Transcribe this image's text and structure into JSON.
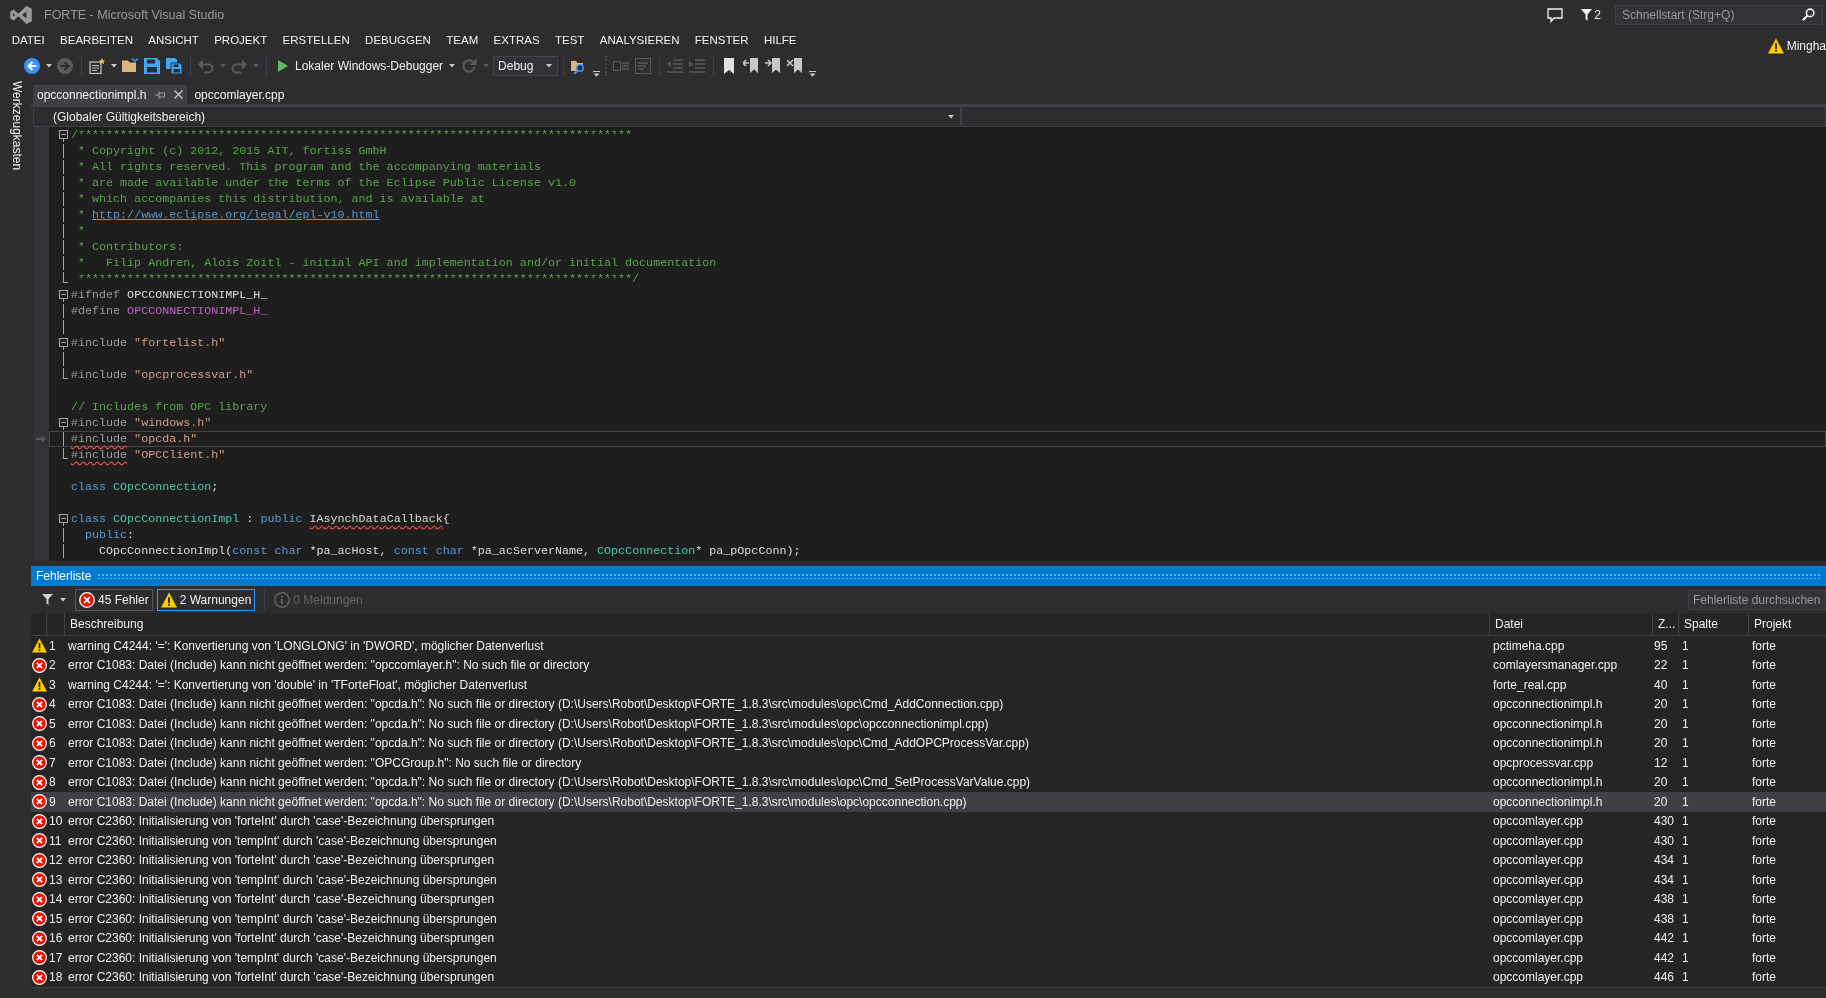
{
  "window": {
    "title": "FORTE - Microsoft Visual Studio",
    "notifications": "2",
    "quick_launch": {
      "placeholder": "Schnellstart (Strg+Q)"
    }
  },
  "menu_bar": {
    "items": [
      "DATEI",
      "BEARBEITEN",
      "ANSICHT",
      "PROJEKT",
      "ERSTELLEN",
      "DEBUGGEN",
      "TEAM",
      "EXTRAS",
      "TEST",
      "ANALYSIEREN",
      "FENSTER",
      "HILFE"
    ],
    "user": "Mingha"
  },
  "toolbar": {
    "items": [
      {
        "kind": "back",
        "disabled": false,
        "dropdown": true
      },
      {
        "kind": "forward",
        "disabled": true,
        "dropdown": false
      },
      {
        "kind": "separator"
      },
      {
        "kind": "new_project",
        "disabled": false,
        "dropdown": true
      },
      {
        "kind": "open",
        "disabled": false,
        "dropdown": false
      },
      {
        "kind": "save",
        "disabled": false,
        "dropdown": false
      },
      {
        "kind": "save_all",
        "disabled": false,
        "dropdown": false
      },
      {
        "kind": "separator"
      },
      {
        "kind": "undo",
        "disabled": true,
        "dropdown": true
      },
      {
        "kind": "redo",
        "disabled": true,
        "dropdown": true
      },
      {
        "kind": "separator"
      },
      {
        "kind": "start",
        "label": "Lokaler Windows-Debugger",
        "disabled": false,
        "dropdown": true
      },
      {
        "kind": "refresh",
        "disabled": true,
        "dropdown": true
      },
      {
        "kind": "select",
        "value": "Debug"
      },
      {
        "kind": "separator"
      },
      {
        "kind": "find",
        "disabled": false,
        "dropdown": false
      },
      {
        "kind": "overflow"
      },
      {
        "kind": "grip"
      },
      {
        "kind": "member_list",
        "disabled": true,
        "dropdown": false
      },
      {
        "kind": "parameter_info",
        "disabled": true,
        "dropdown": false
      },
      {
        "kind": "separator"
      },
      {
        "kind": "outdent",
        "disabled": true,
        "dropdown": false
      },
      {
        "kind": "indent",
        "disabled": true,
        "dropdown": false
      },
      {
        "kind": "separator"
      },
      {
        "kind": "bookmark",
        "disabled": false,
        "dropdown": false
      },
      {
        "kind": "bookmark_prev",
        "disabled": false,
        "dropdown": false
      },
      {
        "kind": "bookmark_next",
        "disabled": false,
        "dropdown": false
      },
      {
        "kind": "bookmark_clear",
        "disabled": false,
        "dropdown": false
      },
      {
        "kind": "overflow"
      }
    ]
  },
  "sidebar": {
    "tabs": [
      "Werkzeugkasten"
    ]
  },
  "tabs": [
    {
      "label": "opcconnectionimpl.h",
      "selected": true
    },
    {
      "label": "opccomlayer.cpp",
      "selected": false
    }
  ],
  "scope_bar": {
    "scope": "(Globaler Gültigkeitsbereich)"
  },
  "editor": {
    "lines": [
      {
        "kind": "open",
        "current": false,
        "tokens": [
          {
            "text": "/*******************************************************************************",
            "kind": "comment",
            "squiggle": false
          }
        ]
      },
      {
        "kind": "inner",
        "current": false,
        "tokens": [
          {
            "text": " * Copyright (c) 2012, 2015 AIT, fortiss GmbH",
            "kind": "comment",
            "squiggle": false
          }
        ]
      },
      {
        "kind": "inner",
        "current": false,
        "tokens": [
          {
            "text": " * All rights reserved. This program and the accompanying materials",
            "kind": "comment",
            "squiggle": false
          }
        ]
      },
      {
        "kind": "inner",
        "current": false,
        "tokens": [
          {
            "text": " * are made available under the terms of the Eclipse Public License v1.0",
            "kind": "comment",
            "squiggle": false
          }
        ]
      },
      {
        "kind": "inner",
        "current": false,
        "tokens": [
          {
            "text": " * which accompanies this distribution, and is available at",
            "kind": "comment",
            "squiggle": false
          }
        ]
      },
      {
        "kind": "inner",
        "current": false,
        "tokens": [
          {
            "text": " * ",
            "kind": "comment",
            "squiggle": false
          },
          {
            "text": "http://www.eclipse.org/legal/epl-v10.html",
            "kind": "link",
            "squiggle": false
          }
        ]
      },
      {
        "kind": "inner",
        "current": false,
        "tokens": [
          {
            "text": " *",
            "kind": "comment",
            "squiggle": false
          }
        ]
      },
      {
        "kind": "inner",
        "current": false,
        "tokens": [
          {
            "text": " * Contributors:",
            "kind": "comment",
            "squiggle": false
          }
        ]
      },
      {
        "kind": "inner",
        "current": false,
        "tokens": [
          {
            "text": " *   Filip Andren, Alois Zoitl - initial API and implementation and/or initial documentation",
            "kind": "comment",
            "squiggle": false
          }
        ]
      },
      {
        "kind": "end",
        "current": false,
        "tokens": [
          {
            "text": " *******************************************************************************/",
            "kind": "comment",
            "squiggle": false
          }
        ]
      },
      {
        "kind": "open",
        "current": false,
        "tokens": [
          {
            "text": "#ifndef",
            "kind": "directive",
            "squiggle": false
          },
          {
            "text": " OPCCONNECTIONIMPL_H_",
            "kind": "plain",
            "squiggle": false
          }
        ]
      },
      {
        "kind": "inner",
        "current": false,
        "tokens": [
          {
            "text": "#define",
            "kind": "directive",
            "squiggle": false
          },
          {
            "text": " OPCCONNECTIONIMPL_H_",
            "kind": "macro",
            "squiggle": false
          }
        ]
      },
      {
        "kind": "inner",
        "current": false
      },
      {
        "kind": "open",
        "current": false,
        "tokens": [
          {
            "text": "#include",
            "kind": "directive",
            "squiggle": false
          },
          {
            "text": " \"fortelist.h\"",
            "kind": "string",
            "squiggle": false
          }
        ]
      },
      {
        "kind": "inner",
        "current": false
      },
      {
        "kind": "end",
        "current": false,
        "tokens": [
          {
            "text": "#include",
            "kind": "directive",
            "squiggle": false
          },
          {
            "text": " \"opcprocessvar.h\"",
            "kind": "string",
            "squiggle": false
          }
        ]
      },
      {
        "kind": "none",
        "current": false
      },
      {
        "kind": "none",
        "current": false,
        "tokens": [
          {
            "text": "// Includes from OPC library",
            "kind": "comment",
            "squiggle": false
          }
        ]
      },
      {
        "kind": "open",
        "current": false,
        "tokens": [
          {
            "text": "#include",
            "kind": "directive",
            "squiggle": false
          },
          {
            "text": " \"windows.h\"",
            "kind": "string",
            "squiggle": false
          }
        ]
      },
      {
        "kind": "inner",
        "current": true,
        "tokens": [
          {
            "text": "#include",
            "kind": "directive",
            "squiggle": true
          },
          {
            "text": " \"opcda.h\"",
            "kind": "string",
            "squiggle": false
          }
        ]
      },
      {
        "kind": "end",
        "current": false,
        "tokens": [
          {
            "text": "#include",
            "kind": "directive",
            "squiggle": true
          },
          {
            "text": " \"OPCClient.h\"",
            "kind": "string",
            "squiggle": false
          }
        ]
      },
      {
        "kind": "none",
        "current": false
      },
      {
        "kind": "none",
        "current": false,
        "tokens": [
          {
            "text": "class",
            "kind": "keyword",
            "squiggle": false
          },
          {
            "text": " COpcConnection",
            "kind": "type",
            "squiggle": false
          },
          {
            "text": ";",
            "kind": "plain",
            "squiggle": false
          }
        ]
      },
      {
        "kind": "none",
        "current": false
      },
      {
        "kind": "open",
        "current": false,
        "tokens": [
          {
            "text": "class",
            "kind": "keyword",
            "squiggle": false
          },
          {
            "text": " COpcConnectionImpl",
            "kind": "type",
            "squiggle": false
          },
          {
            "text": " : ",
            "kind": "plain",
            "squiggle": false
          },
          {
            "text": "public ",
            "kind": "keyword",
            "squiggle": false
          },
          {
            "text": "IAsynchDataCallback",
            "kind": "plain",
            "squiggle": true
          },
          {
            "text": "{",
            "kind": "plain",
            "squiggle": false
          }
        ]
      },
      {
        "kind": "inner",
        "current": false,
        "tokens": [
          {
            "text": "  public",
            "kind": "keyword",
            "squiggle": false
          },
          {
            "text": ":",
            "kind": "plain",
            "squiggle": false
          }
        ]
      },
      {
        "kind": "inner",
        "current": false,
        "tokens": [
          {
            "text": "    COpcConnectionImpl(",
            "kind": "plain",
            "squiggle": false
          },
          {
            "text": "const char",
            "kind": "keyword",
            "squiggle": false
          },
          {
            "text": " *pa_acHost, ",
            "kind": "plain",
            "squiggle": false
          },
          {
            "text": "const char",
            "kind": "keyword",
            "squiggle": false
          },
          {
            "text": " *pa_acServerName, ",
            "kind": "plain",
            "squiggle": false
          },
          {
            "text": "COpcConnection",
            "kind": "type",
            "squiggle": false
          },
          {
            "text": "* pa_pOpcConn);",
            "kind": "plain",
            "squiggle": false
          }
        ]
      }
    ]
  },
  "error_list": {
    "title": "Fehlerliste",
    "filters": [
      {
        "kind": "error",
        "label": "45 Fehler",
        "selected": true,
        "focused": false
      },
      {
        "kind": "warning",
        "label": "2 Warnungen",
        "selected": true,
        "focused": true
      },
      {
        "kind": "info",
        "label": "0 Meldungen",
        "selected": false,
        "focused": false
      }
    ],
    "search": {
      "placeholder": "Fehlerliste durchsuchen"
    },
    "columns": [
      "Beschreibung",
      "Datei",
      "Z...",
      "Spalte",
      "Projekt"
    ],
    "rows": [
      {
        "kind": "warning",
        "number": "1",
        "description": "warning C4244: '=': Konvertierung von 'LONGLONG' in 'DWORD', möglicher Datenverlust",
        "file": "pctimeha.cpp",
        "line": "95",
        "column": "1",
        "project": "forte",
        "selected": false
      },
      {
        "kind": "error",
        "number": "2",
        "description": "error C1083: Datei (Include) kann nicht geöffnet werden: \"opccomlayer.h\": No such file or directory",
        "file": "comlayersmanager.cpp",
        "line": "22",
        "column": "1",
        "project": "forte",
        "selected": false
      },
      {
        "kind": "warning",
        "number": "3",
        "description": "warning C4244: '=': Konvertierung von 'double' in 'TForteFloat', möglicher Datenverlust",
        "file": "forte_real.cpp",
        "line": "40",
        "column": "1",
        "project": "forte",
        "selected": false
      },
      {
        "kind": "error",
        "number": "4",
        "description": "error C1083: Datei (Include) kann nicht geöffnet werden: \"opcda.h\": No such file or directory (D:\\Users\\Robot\\Desktop\\FORTE_1.8.3\\src\\modules\\opc\\Cmd_AddConnection.cpp)",
        "file": "opcconnectionimpl.h",
        "line": "20",
        "column": "1",
        "project": "forte",
        "selected": false
      },
      {
        "kind": "error",
        "number": "5",
        "description": "error C1083: Datei (Include) kann nicht geöffnet werden: \"opcda.h\": No such file or directory (D:\\Users\\Robot\\Desktop\\FORTE_1.8.3\\src\\modules\\opc\\opcconnectionimpl.cpp)",
        "file": "opcconnectionimpl.h",
        "line": "20",
        "column": "1",
        "project": "forte",
        "selected": false
      },
      {
        "kind": "error",
        "number": "6",
        "description": "error C1083: Datei (Include) kann nicht geöffnet werden: \"opcda.h\": No such file or directory (D:\\Users\\Robot\\Desktop\\FORTE_1.8.3\\src\\modules\\opc\\Cmd_AddOPCProcessVar.cpp)",
        "file": "opcconnectionimpl.h",
        "line": "20",
        "column": "1",
        "project": "forte",
        "selected": false
      },
      {
        "kind": "error",
        "number": "7",
        "description": "error C1083: Datei (Include) kann nicht geöffnet werden: \"OPCGroup.h\": No such file or directory",
        "file": "opcprocessvar.cpp",
        "line": "12",
        "column": "1",
        "project": "forte",
        "selected": false
      },
      {
        "kind": "error",
        "number": "8",
        "description": "error C1083: Datei (Include) kann nicht geöffnet werden: \"opcda.h\": No such file or directory (D:\\Users\\Robot\\Desktop\\FORTE_1.8.3\\src\\modules\\opc\\Cmd_SetProcessVarValue.cpp)",
        "file": "opcconnectionimpl.h",
        "line": "20",
        "column": "1",
        "project": "forte",
        "selected": false
      },
      {
        "kind": "error",
        "number": "9",
        "description": "error C1083: Datei (Include) kann nicht geöffnet werden: \"opcda.h\": No such file or directory (D:\\Users\\Robot\\Desktop\\FORTE_1.8.3\\src\\modules\\opc\\opcconnection.cpp)",
        "file": "opcconnectionimpl.h",
        "line": "20",
        "column": "1",
        "project": "forte",
        "selected": true
      },
      {
        "kind": "error",
        "number": "10",
        "description": "error C2360: Initialisierung von 'forteInt' durch 'case'-Bezeichnung übersprungen",
        "file": "opccomlayer.cpp",
        "line": "430",
        "column": "1",
        "project": "forte",
        "selected": false
      },
      {
        "kind": "error",
        "number": "11",
        "description": "error C2360: Initialisierung von 'tempInt' durch 'case'-Bezeichnung übersprungen",
        "file": "opccomlayer.cpp",
        "line": "430",
        "column": "1",
        "project": "forte",
        "selected": false
      },
      {
        "kind": "error",
        "number": "12",
        "description": "error C2360: Initialisierung von 'forteInt' durch 'case'-Bezeichnung übersprungen",
        "file": "opccomlayer.cpp",
        "line": "434",
        "column": "1",
        "project": "forte",
        "selected": false
      },
      {
        "kind": "error",
        "number": "13",
        "description": "error C2360: Initialisierung von 'tempInt' durch 'case'-Bezeichnung übersprungen",
        "file": "opccomlayer.cpp",
        "line": "434",
        "column": "1",
        "project": "forte",
        "selected": false
      },
      {
        "kind": "error",
        "number": "14",
        "description": "error C2360: Initialisierung von 'forteInt' durch 'case'-Bezeichnung übersprungen",
        "file": "opccomlayer.cpp",
        "line": "438",
        "column": "1",
        "project": "forte",
        "selected": false
      },
      {
        "kind": "error",
        "number": "15",
        "description": "error C2360: Initialisierung von 'tempInt' durch 'case'-Bezeichnung übersprungen",
        "file": "opccomlayer.cpp",
        "line": "438",
        "column": "1",
        "project": "forte",
        "selected": false
      },
      {
        "kind": "error",
        "number": "16",
        "description": "error C2360: Initialisierung von 'forteInt' durch 'case'-Bezeichnung übersprungen",
        "file": "opccomlayer.cpp",
        "line": "442",
        "column": "1",
        "project": "forte",
        "selected": false
      },
      {
        "kind": "error",
        "number": "17",
        "description": "error C2360: Initialisierung von 'tempInt' durch 'case'-Bezeichnung übersprungen",
        "file": "opccomlayer.cpp",
        "line": "442",
        "column": "1",
        "project": "forte",
        "selected": false
      },
      {
        "kind": "error",
        "number": "18",
        "description": "error C2360: Initialisierung von 'forteInt' durch 'case'-Bezeichnung übersprungen",
        "file": "opccomlayer.cpp",
        "line": "446",
        "column": "1",
        "project": "forte",
        "selected": false
      }
    ]
  }
}
